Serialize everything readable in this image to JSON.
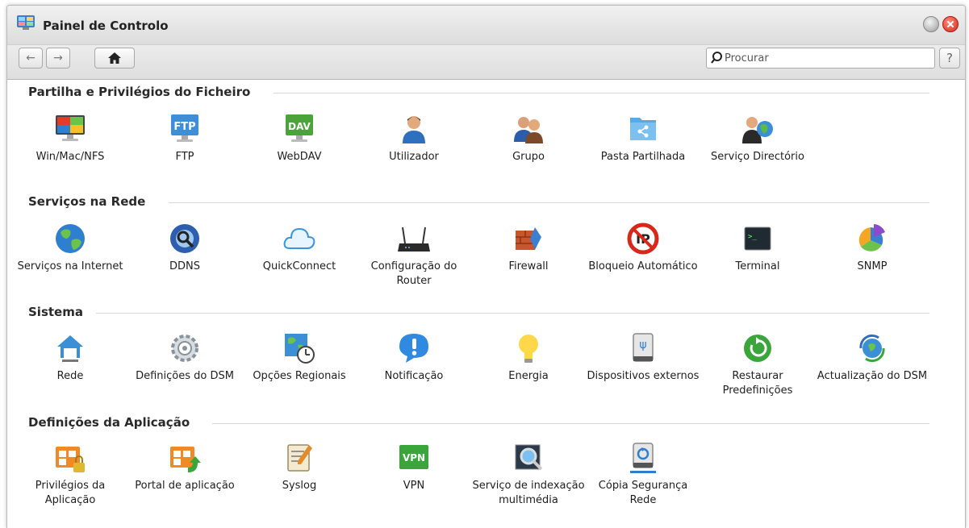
{
  "window": {
    "title": "Painel de Controlo"
  },
  "toolbar": {
    "search_placeholder": "Procurar",
    "help_label": "?"
  },
  "sections": [
    {
      "title": "Partilha e Privilégios do Ficheiro",
      "items": [
        {
          "label": "Win/Mac/NFS",
          "icon": "monitor-icon"
        },
        {
          "label": "FTP",
          "icon": "ftp-icon"
        },
        {
          "label": "WebDAV",
          "icon": "webdav-icon"
        },
        {
          "label": "Utilizador",
          "icon": "user-icon"
        },
        {
          "label": "Grupo",
          "icon": "group-icon"
        },
        {
          "label": "Pasta Partilhada",
          "icon": "shared-folder-icon"
        },
        {
          "label": "Serviço Directório",
          "icon": "directory-service-icon"
        }
      ]
    },
    {
      "title": "Serviços na Rede",
      "items": [
        {
          "label": "Serviços na Internet",
          "icon": "globe-icon"
        },
        {
          "label": "DDNS",
          "icon": "ddns-icon"
        },
        {
          "label": "QuickConnect",
          "icon": "cloud-icon"
        },
        {
          "label": "Configuração do Router",
          "icon": "router-icon"
        },
        {
          "label": "Firewall",
          "icon": "firewall-icon"
        },
        {
          "label": "Bloqueio Automático",
          "icon": "block-icon"
        },
        {
          "label": "Terminal",
          "icon": "terminal-icon"
        },
        {
          "label": "SNMP",
          "icon": "pie-chart-icon"
        }
      ]
    },
    {
      "title": "Sistema",
      "items": [
        {
          "label": "Rede",
          "icon": "home-network-icon"
        },
        {
          "label": "Definições do DSM",
          "icon": "gear-icon"
        },
        {
          "label": "Opções Regionais",
          "icon": "map-clock-icon"
        },
        {
          "label": "Notificação",
          "icon": "notification-icon"
        },
        {
          "label": "Energia",
          "icon": "lightbulb-icon"
        },
        {
          "label": "Dispositivos externos",
          "icon": "usb-drive-icon"
        },
        {
          "label": "Restaurar Predefinições",
          "icon": "restore-icon"
        },
        {
          "label": "Actualização do DSM",
          "icon": "update-icon"
        }
      ]
    },
    {
      "title": "Definições da Aplicação",
      "items": [
        {
          "label": "Privilégios da Aplicação",
          "icon": "app-lock-icon"
        },
        {
          "label": "Portal de aplicação",
          "icon": "app-portal-icon"
        },
        {
          "label": "Syslog",
          "icon": "syslog-icon"
        },
        {
          "label": "VPN",
          "icon": "vpn-icon"
        },
        {
          "label": "Serviço de indexação multimédia",
          "icon": "media-index-icon"
        },
        {
          "label": "Cópia Segurança Rede",
          "icon": "network-backup-icon"
        }
      ]
    }
  ],
  "colors": {
    "accent_blue": "#2f7fd0",
    "close_red": "#d42a1a",
    "green": "#3aa53a"
  }
}
